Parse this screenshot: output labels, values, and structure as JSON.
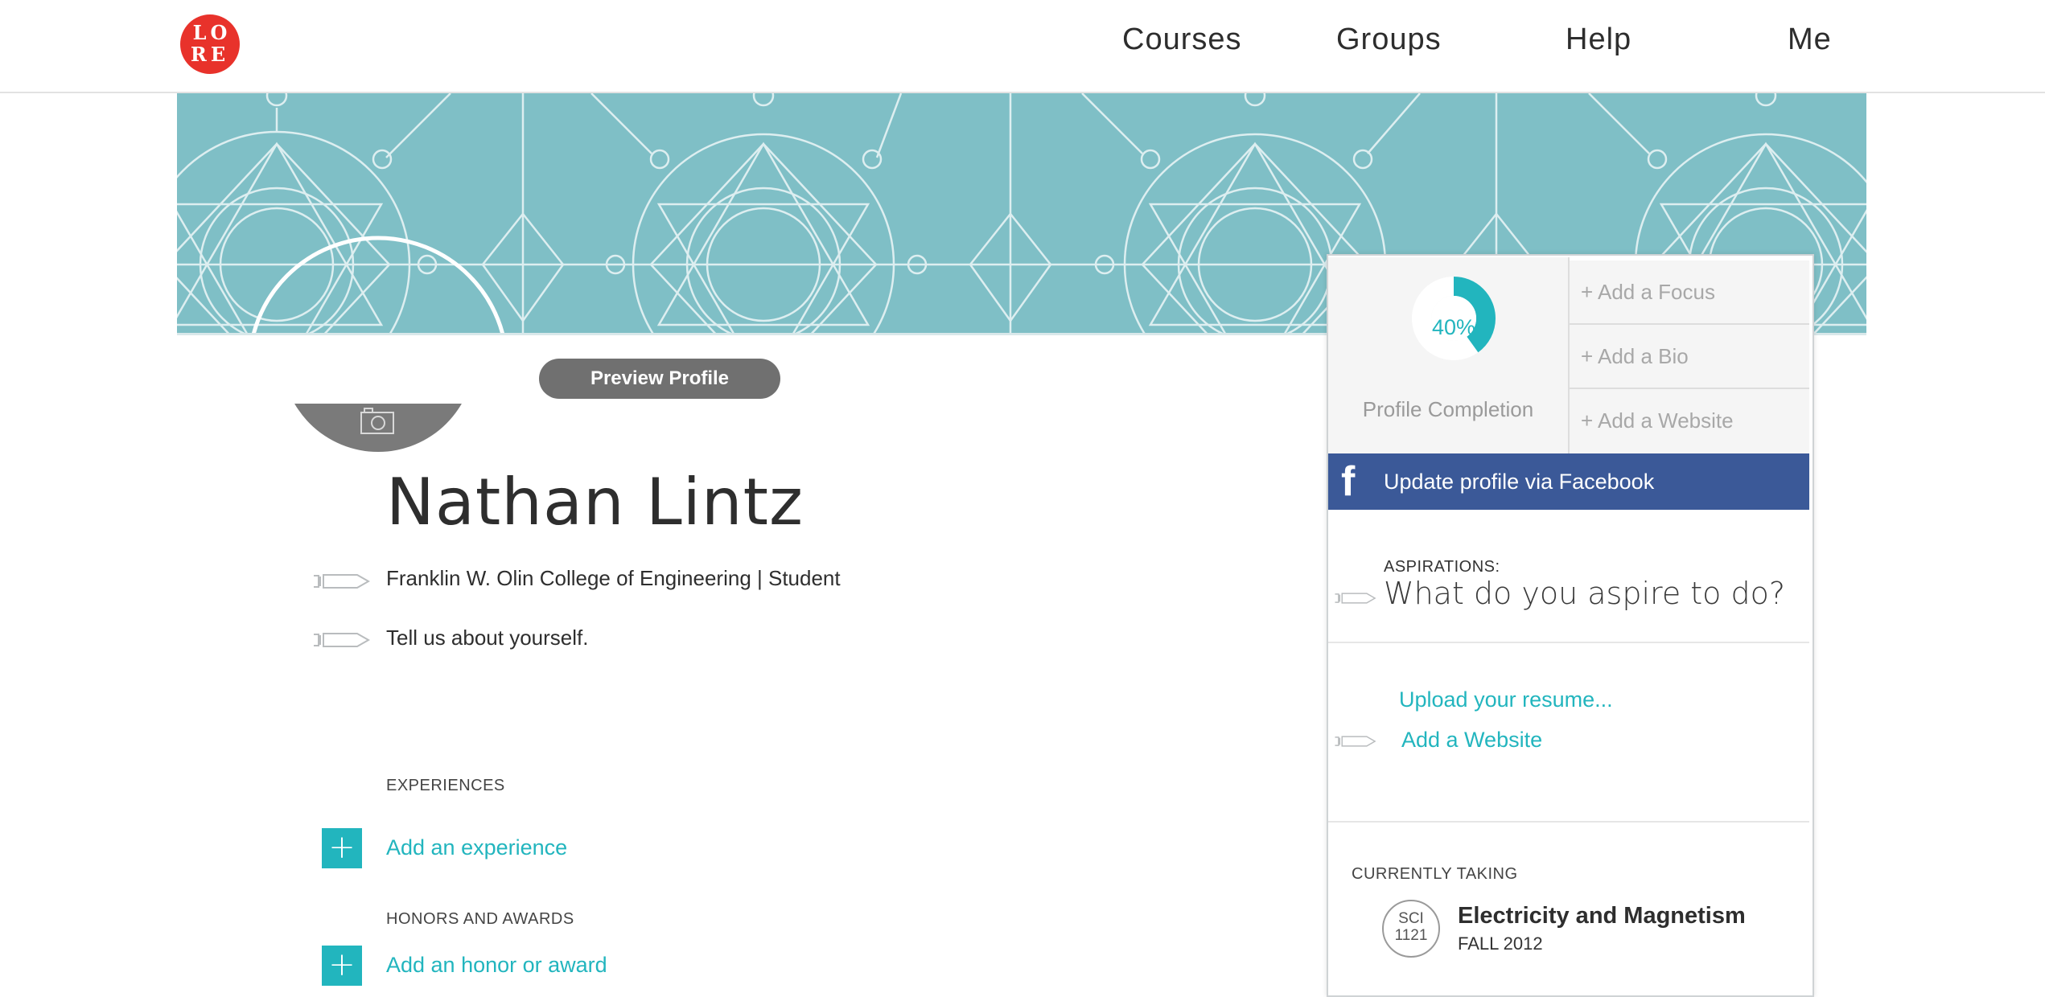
{
  "logo": {
    "text_line1": "LO",
    "text_line2": "RE"
  },
  "nav": {
    "courses": "Courses",
    "groups": "Groups",
    "help": "Help",
    "me": "Me"
  },
  "profile": {
    "preview_button": "Preview Profile",
    "name": "Nathan Lintz",
    "school_line": "Franklin W. Olin College of Engineering | Student",
    "about_prompt": "Tell us about yourself."
  },
  "experiences": {
    "label": "EXPERIENCES",
    "add_link": "Add an experience"
  },
  "honors": {
    "label": "HONORS AND AWARDS",
    "add_link": "Add an honor or award"
  },
  "completion": {
    "percent_text": "40%",
    "fraction": 0.4,
    "label": "Profile Completion",
    "items": [
      "+ Add a Focus",
      "+ Add a Bio",
      "+ Add a Website"
    ]
  },
  "facebook": {
    "icon": "f",
    "label": "Update profile via Facebook"
  },
  "aspirations": {
    "label": "ASPIRATIONS:",
    "prompt": "What do you aspire to do?"
  },
  "links": {
    "resume": "Upload your resume...",
    "website": "Add a Website"
  },
  "currently_taking": {
    "label": "CURRENTLY TAKING",
    "course_code_line1": "SCI",
    "course_code_line2": "1121",
    "course_title": "Electricity and Magnetism",
    "course_term": "FALL 2012"
  },
  "colors": {
    "accent_teal": "#22b5be",
    "banner_teal": "#7fbfc6",
    "facebook_blue": "#3b5998",
    "logo_red": "#e8322b"
  },
  "icons": [
    "camera-icon",
    "pencil-icon",
    "plus-icon",
    "facebook-icon",
    "course-badge-icon"
  ]
}
